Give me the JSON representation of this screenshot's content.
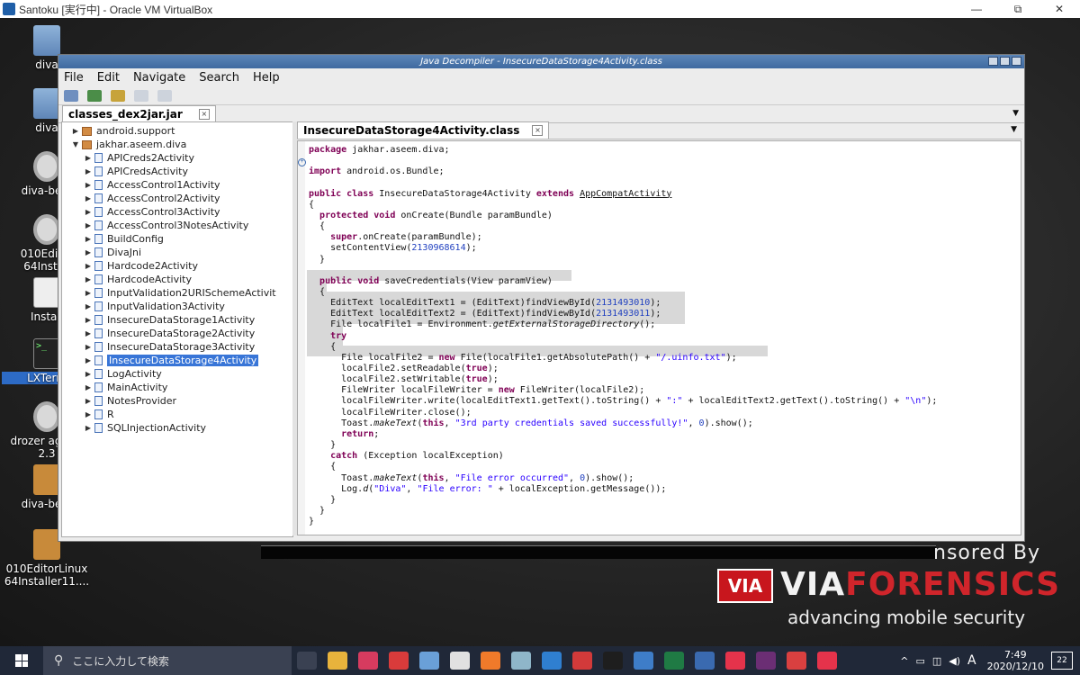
{
  "host": {
    "title": "Santoku [実行中] - Oracle VM VirtualBox",
    "minimize": "—",
    "restore": "⧉",
    "close": "✕"
  },
  "desktop_icons": [
    {
      "label": "diva",
      "icon": "folder-icon"
    },
    {
      "label": "diva",
      "icon": "folder-icon"
    },
    {
      "label": "diva-beta",
      "icon": "gear-icon"
    },
    {
      "label": "010Editor 64Install",
      "icon": "gear-icon"
    },
    {
      "label": "Install",
      "icon": "document-icon"
    },
    {
      "label": "LXTerm",
      "icon": "terminal-icon"
    },
    {
      "label": "drozer agent-2.3",
      "icon": "gear-icon"
    },
    {
      "label": "diva-beta",
      "icon": "package-icon"
    },
    {
      "label": "010EditorLinux 64Installer11....",
      "icon": "package-icon"
    }
  ],
  "branding": {
    "sponsored": "nsored By",
    "logo_mark": "VIA",
    "word_a": "VIA",
    "word_b": "FORENSICS",
    "tagline": "advancing mobile security"
  },
  "jd": {
    "title": "Java Decompiler - InsecureDataStorage4Activity.class",
    "menu": [
      "File",
      "Edit",
      "Navigate",
      "Search",
      "Help"
    ],
    "outer_tab": "classes_dex2jar.jar",
    "editor_tab": "InsecureDataStorage4Activity.class",
    "tree": [
      {
        "label": "android.support",
        "type": "package",
        "indent": 1,
        "expanded": false
      },
      {
        "label": "jakhar.aseem.diva",
        "type": "package",
        "indent": 1,
        "expanded": true
      },
      {
        "label": "APICreds2Activity",
        "type": "class",
        "indent": 2
      },
      {
        "label": "APICredsActivity",
        "type": "class",
        "indent": 2
      },
      {
        "label": "AccessControl1Activity",
        "type": "class",
        "indent": 2
      },
      {
        "label": "AccessControl2Activity",
        "type": "class",
        "indent": 2
      },
      {
        "label": "AccessControl3Activity",
        "type": "class",
        "indent": 2
      },
      {
        "label": "AccessControl3NotesActivity",
        "type": "class",
        "indent": 2
      },
      {
        "label": "BuildConfig",
        "type": "class",
        "indent": 2
      },
      {
        "label": "DivaJni",
        "type": "class",
        "indent": 2
      },
      {
        "label": "Hardcode2Activity",
        "type": "class",
        "indent": 2
      },
      {
        "label": "HardcodeActivity",
        "type": "class",
        "indent": 2
      },
      {
        "label": "InputValidation2URISchemeActivit",
        "type": "class",
        "indent": 2
      },
      {
        "label": "InputValidation3Activity",
        "type": "class",
        "indent": 2
      },
      {
        "label": "InsecureDataStorage1Activity",
        "type": "class",
        "indent": 2
      },
      {
        "label": "InsecureDataStorage2Activity",
        "type": "class",
        "indent": 2
      },
      {
        "label": "InsecureDataStorage3Activity",
        "type": "class",
        "indent": 2
      },
      {
        "label": "InsecureDataStorage4Activity",
        "type": "class",
        "indent": 2,
        "selected": true
      },
      {
        "label": "LogActivity",
        "type": "class",
        "indent": 2
      },
      {
        "label": "MainActivity",
        "type": "class",
        "indent": 2
      },
      {
        "label": "NotesProvider",
        "type": "class",
        "indent": 2
      },
      {
        "label": "R",
        "type": "class",
        "indent": 2
      },
      {
        "label": "SQLInjectionActivity",
        "type": "class",
        "indent": 2
      }
    ],
    "code_lines": [
      "<span class='kw'>package</span> jakhar.aseem.diva;",
      "",
      "<span class='kw'>import</span> android.os.Bundle;",
      "",
      "<span class='kw'>public class</span> InsecureDataStorage4Activity <span class='kw'>extends</span> <span class='ul'>AppCompatActivity</span>",
      "{",
      "  <span class='kw'>protected void</span> onCreate(Bundle paramBundle)",
      "  {",
      "    <span class='kw'>super</span>.onCreate(paramBundle);",
      "    setContentView(<span class='num'>2130968614</span>);",
      "  }",
      "",
      "  <span class='kw'>public void</span> saveCredentials(View paramView)",
      "  {",
      "    EditText localEditText1 = (EditText)findViewById(<span class='num'>2131493010</span>);",
      "    EditText localEditText2 = (EditText)findViewById(<span class='num'>2131493011</span>);",
      "    File localFile1 = Environment.<span class='it'>getExternalStorageDirectory</span>();",
      "    <span class='kw'>try</span>",
      "    {",
      "      File localFile2 = <span class='kw'>new</span> File(localFile1.getAbsolutePath() + <span class='str'>\"/.uinfo.txt\"</span>);",
      "      localFile2.setReadable(<span class='kw'>true</span>);",
      "      localFile2.setWritable(<span class='kw'>true</span>);",
      "      FileWriter localFileWriter = <span class='kw'>new</span> FileWriter(localFile2);",
      "      localFileWriter.write(localEditText1.getText().toString() + <span class='str'>\":\"</span> + localEditText2.getText().toString() + <span class='str'>\"\\n\"</span>);",
      "      localFileWriter.close();",
      "      Toast.<span class='it'>makeText</span>(<span class='kw'>this</span>, <span class='str'>\"3rd party credentials saved successfully!\"</span>, <span class='num'>0</span>).show();",
      "      <span class='kw'>return</span>;",
      "    }",
      "    <span class='kw'>catch</span> (Exception localException)",
      "    {",
      "      Toast.<span class='it'>makeText</span>(<span class='kw'>this</span>, <span class='str'>\"File error occurred\"</span>, <span class='num'>0</span>).show();",
      "      Log.<span class='it'>d</span>(<span class='str'>\"Diva\"</span>, <span class='str'>\"File error: \"</span> + localException.getMessage());",
      "    }",
      "  }",
      "}"
    ]
  },
  "taskbar": {
    "search_placeholder": "ここに入力して検索",
    "time": "7:49",
    "date": "2020/12/10",
    "ime": "A",
    "notifications": "22",
    "apps": [
      "task-view-icon",
      "explorer-icon",
      "app-red-icon",
      "app-sync-icon",
      "app-blue-icon",
      "chrome-icon",
      "firefox-icon",
      "app-book-icon",
      "app-blue2-icon",
      "app-red2-icon",
      "terminal-icon",
      "photos-icon",
      "excel-icon",
      "virtualbox-icon",
      "app-oo-icon",
      "slack-icon",
      "app-chrome2-icon",
      "app-oo2-icon"
    ]
  }
}
